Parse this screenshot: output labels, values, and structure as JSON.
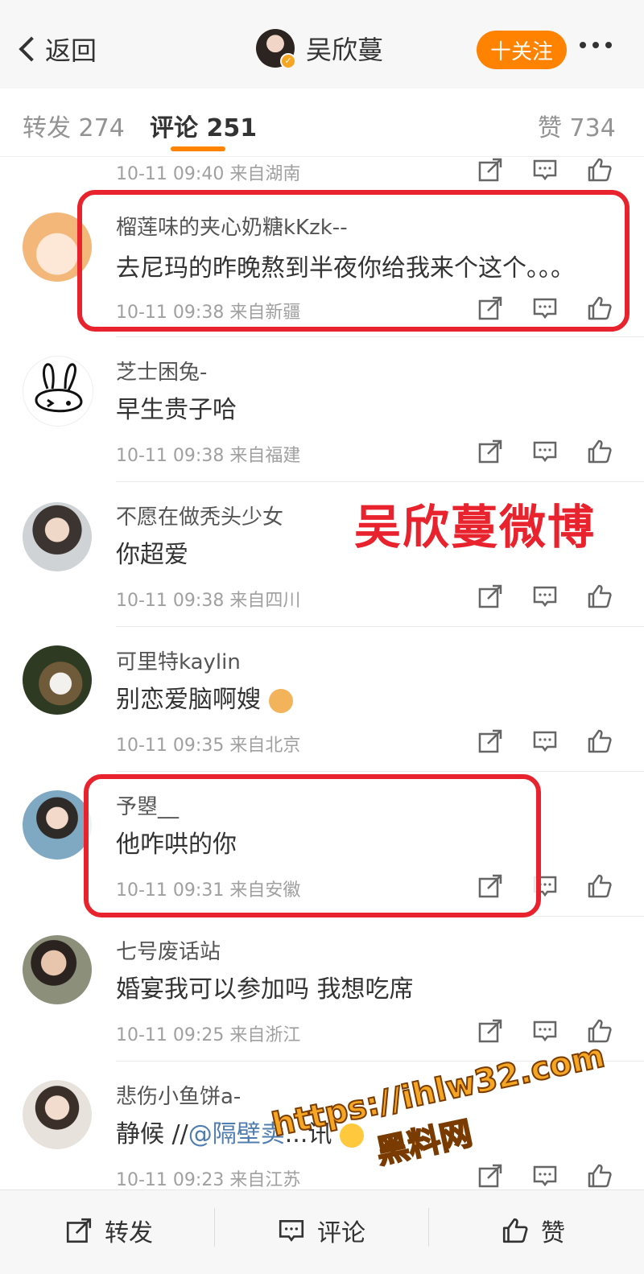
{
  "nav": {
    "back_label": "返回",
    "title": "吴欣蔓",
    "follow_label": "十关注"
  },
  "tabs": {
    "repost": "转发 274",
    "comment": "评论 251",
    "like": "赞 734"
  },
  "top_partial": {
    "meta": "10-11 09:40 来自湖南"
  },
  "comments": [
    {
      "name": "榴莲味的夹心奶糖kKzk--",
      "text": "去尼玛的昨晚熬到半夜你给我来个这个。。。",
      "meta": "10-11 09:38 来自新疆"
    },
    {
      "name": "芝士困兔-",
      "text": "早生贵子哈",
      "meta": "10-11 09:38 来自福建"
    },
    {
      "name": "不愿在做秃头少女",
      "text": "你超爱",
      "meta": "10-11 09:38 来自四川"
    },
    {
      "name": "可里特kaylin",
      "text": "别恋爱脑啊嫂",
      "meta": "10-11 09:35 来自北京"
    },
    {
      "name": "予曌__",
      "text": "他咋哄的你",
      "meta": "10-11 09:31 来自安徽"
    },
    {
      "name": "七号废话站",
      "text": "婚宴我可以参加吗 我想吃席",
      "meta": "10-11 09:25 来自浙江"
    },
    {
      "name": "悲伤小鱼饼a-",
      "text_prefix": "静候 //",
      "mention": "@隔壁卖",
      "text_suffix": "...讯",
      "meta": "10-11 09:23 来自江苏"
    }
  ],
  "overlay": {
    "label": "吴欣蔓微博",
    "watermark_line1": "https://ihlw32.com",
    "watermark_line2": "黑料网"
  },
  "bottom": {
    "repost": "转发",
    "comment": "评论",
    "like": "赞"
  },
  "colors": {
    "accent": "#ff8200",
    "highlight": "#e8232d",
    "mention": "#507daf"
  }
}
